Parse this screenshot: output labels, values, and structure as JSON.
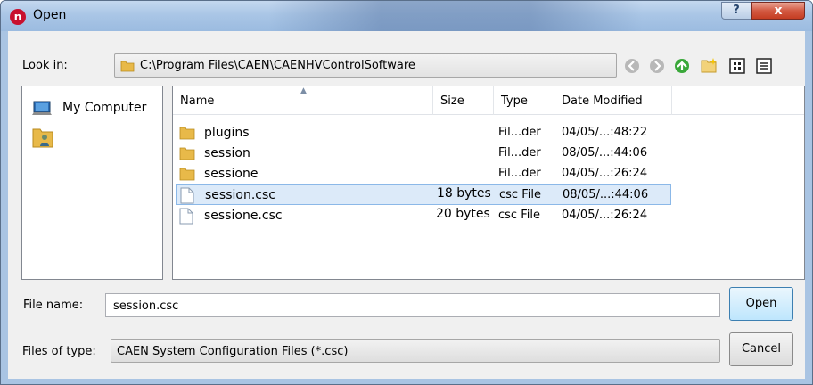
{
  "window": {
    "title": "Open",
    "app_icon_letter": "n",
    "help_label": "?",
    "close_label": "x"
  },
  "lookin": {
    "label": "Look in:",
    "path": "C:\\Program Files\\CAEN\\CAENHVControlSoftware"
  },
  "toolbar": {
    "icons": [
      "back-icon",
      "forward-icon",
      "up-folder-icon",
      "new-folder-icon",
      "list-view-icon",
      "details-view-icon"
    ]
  },
  "sidebar": {
    "items": [
      {
        "label": "My Computer",
        "icon": "computer-icon"
      },
      {
        "label": "",
        "icon": "user-folder-icon"
      }
    ]
  },
  "filelist": {
    "columns": [
      "Name",
      "Size",
      "Type",
      "Date Modified"
    ],
    "sort_column": "Name",
    "rows": [
      {
        "name": "plugins",
        "size": "",
        "type": "Fil...der",
        "date": "04/05/...:48:22",
        "kind": "folder",
        "selected": false
      },
      {
        "name": "session",
        "size": "",
        "type": "Fil...der",
        "date": "08/05/...:44:06",
        "kind": "folder",
        "selected": false
      },
      {
        "name": "sessione",
        "size": "",
        "type": "Fil...der",
        "date": "04/05/...:26:24",
        "kind": "folder",
        "selected": false
      },
      {
        "name": "session.csc",
        "size": "18 bytes",
        "type": "csc File",
        "date": "08/05/...:44:06",
        "kind": "file",
        "selected": true
      },
      {
        "name": "sessione.csc",
        "size": "20 bytes",
        "type": "csc File",
        "date": "04/05/...:26:24",
        "kind": "file",
        "selected": false
      }
    ]
  },
  "bottom": {
    "file_name_label": "File name:",
    "file_name_value": "session.csc",
    "open_label": "Open",
    "file_type_label": "Files of type:",
    "file_type_value": "CAEN System Configuration Files (*.csc)",
    "cancel_label": "Cancel"
  },
  "colors": {
    "selection": "#dceaf9",
    "accent": "#3c7fb1",
    "close": "#c53d22",
    "folder": "#e8b949"
  }
}
